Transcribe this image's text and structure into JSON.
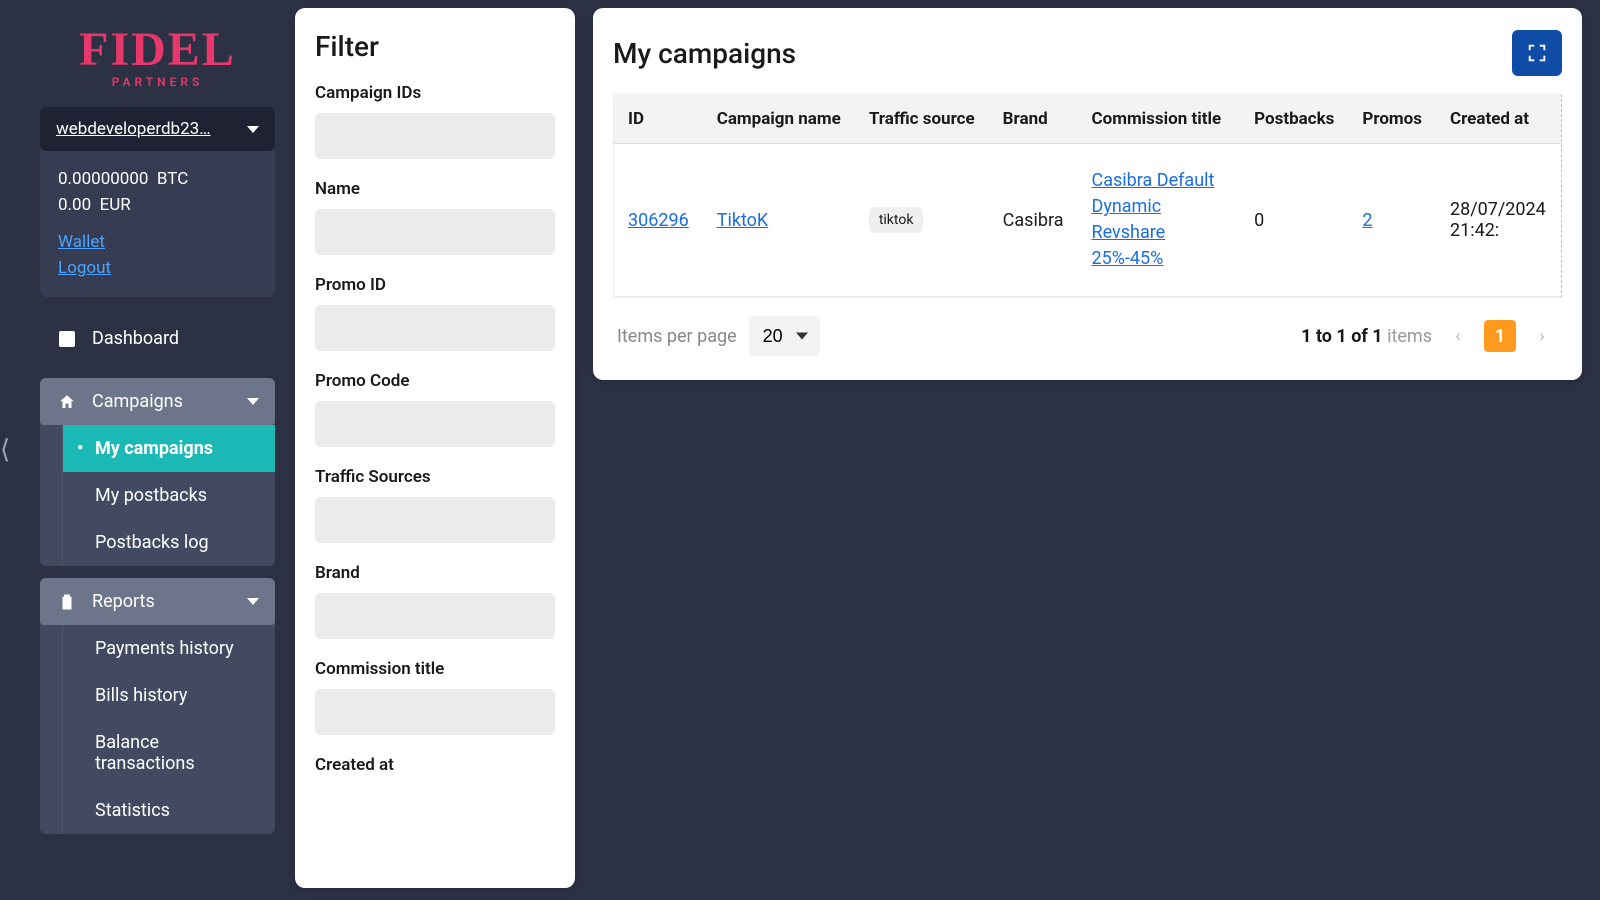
{
  "logo": {
    "main": "FIDEL",
    "sub": "PARTNERS"
  },
  "user": {
    "name_truncated": "webdeveloperdb23…",
    "balance_btc": "0.00000000",
    "currency_btc": "BTC",
    "balance_eur": "0.00",
    "currency_eur": "EUR",
    "wallet_label": "Wallet",
    "logout_label": "Logout"
  },
  "nav": {
    "dashboard": "Dashboard",
    "campaigns": {
      "label": "Campaigns",
      "items": [
        "My campaigns",
        "My postbacks",
        "Postbacks log"
      ],
      "active_index": 0
    },
    "reports": {
      "label": "Reports",
      "items": [
        "Payments history",
        "Bills history",
        "Balance transactions",
        "Statistics"
      ]
    }
  },
  "filter": {
    "title": "Filter",
    "fields": {
      "campaign_ids": "Campaign IDs",
      "name": "Name",
      "promo_id": "Promo ID",
      "promo_code": "Promo Code",
      "traffic_sources": "Traffic Sources",
      "brand": "Brand",
      "commission_title": "Commission title",
      "created_at": "Created at"
    }
  },
  "content": {
    "title": "My campaigns",
    "columns": [
      "ID",
      "Campaign name",
      "Traffic source",
      "Brand",
      "Commission title",
      "Postbacks",
      "Promos",
      "Created at"
    ],
    "rows": [
      {
        "id": "306296",
        "name": "TiktoK",
        "traffic_source": "tiktok",
        "brand": "Casibra",
        "commission_title": "Casibra Default Dynamic Revshare 25%-45%",
        "postbacks": "0",
        "promos": "2",
        "created_at": "28/07/2024 21:42:"
      }
    ],
    "pager": {
      "items_per_page_label": "Items per page",
      "items_per_page_value": "20",
      "range_prefix": "1 to 1 of 1",
      "range_suffix": "items",
      "current_page": "1"
    }
  }
}
